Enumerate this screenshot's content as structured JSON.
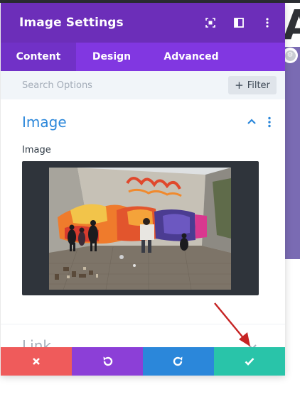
{
  "modal": {
    "title": "Image Settings",
    "tabs": [
      {
        "label": "Content",
        "active": true
      },
      {
        "label": "Design",
        "active": false
      },
      {
        "label": "Advanced",
        "active": false
      }
    ],
    "search": {
      "placeholder": "Search Options",
      "value": ""
    },
    "filter_label": "Filter",
    "section": {
      "title": "Image",
      "field_label": "Image"
    },
    "collapsed_section": {
      "title": "Link"
    }
  },
  "icons": {
    "header": [
      "fullscreen-icon",
      "sidebar-toggle-icon",
      "more-vertical-icon"
    ],
    "footer": [
      "close-icon",
      "undo-icon",
      "redo-icon",
      "check-icon"
    ]
  },
  "colors": {
    "header": "#6c2eb9",
    "tabs": "#8137e1",
    "active_tab": "#7131c7",
    "accent_blue": "#2b87da",
    "cancel": "#ef5b5b",
    "undo": "#8c3fd7",
    "redo": "#2b87da",
    "save": "#29c4a9",
    "annotation_arrow": "#c62424"
  }
}
